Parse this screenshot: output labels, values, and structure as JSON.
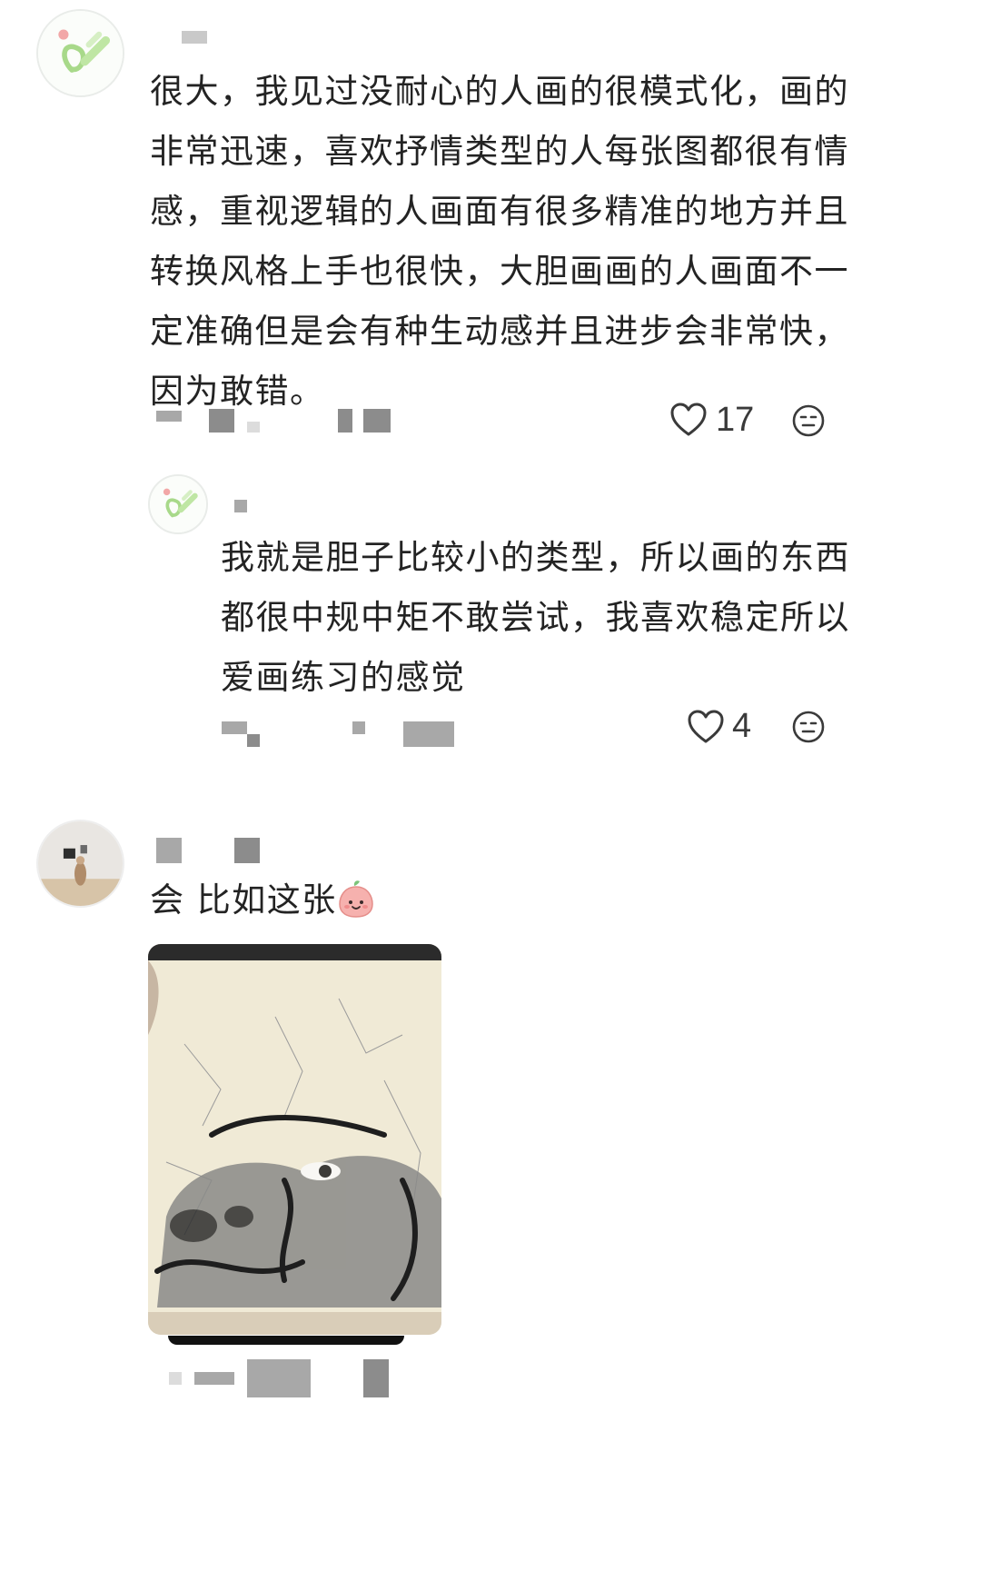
{
  "comments": [
    {
      "text": "很大，我见过没耐心的人画的很模式化，画的非常迅速，喜欢抒情类型的人每张图都很有情感，重视逻辑的人画面有很多精准的地方并且转换风格上手也很快，大胆画画的人画面不一定准确但是会有种生动感并且进步会非常快，因为敢错。",
      "lines": [
        "很大，我见过没耐心的人画的很模式化，画的",
        "非常迅速，喜欢抒情类型的人每张图都很有情",
        "感，重视逻辑的人画面有很多精准的地方并且",
        "转换风格上手也很快，大胆画画的人画面不一",
        "定准确但是会有种生动感并且进步会非常快，",
        "因为敢错。"
      ],
      "likes": "17",
      "avatar_icon": "green-doodle-avatar-icon"
    },
    {
      "is_reply": true,
      "lines": [
        "我就是胆子比较小的类型，所以画的东西",
        "都很中规中矩不敢尝试，我喜欢稳定所以",
        "爱画练习的感觉"
      ],
      "likes": "4",
      "avatar_icon": "green-doodle-avatar-icon"
    },
    {
      "text": "会 比如这张",
      "avatar_icon": "gallery-photo-avatar-icon",
      "emoji": "peach-face-emoji",
      "image": "ink-sketch-photo"
    }
  ],
  "icons": {
    "like": "heart-outline-icon",
    "reaction": "neutral-face-icon"
  },
  "colors": {
    "text": "#232323",
    "avatar_green": "#a8d98a",
    "avatar_pink": "#f2a7a7"
  }
}
